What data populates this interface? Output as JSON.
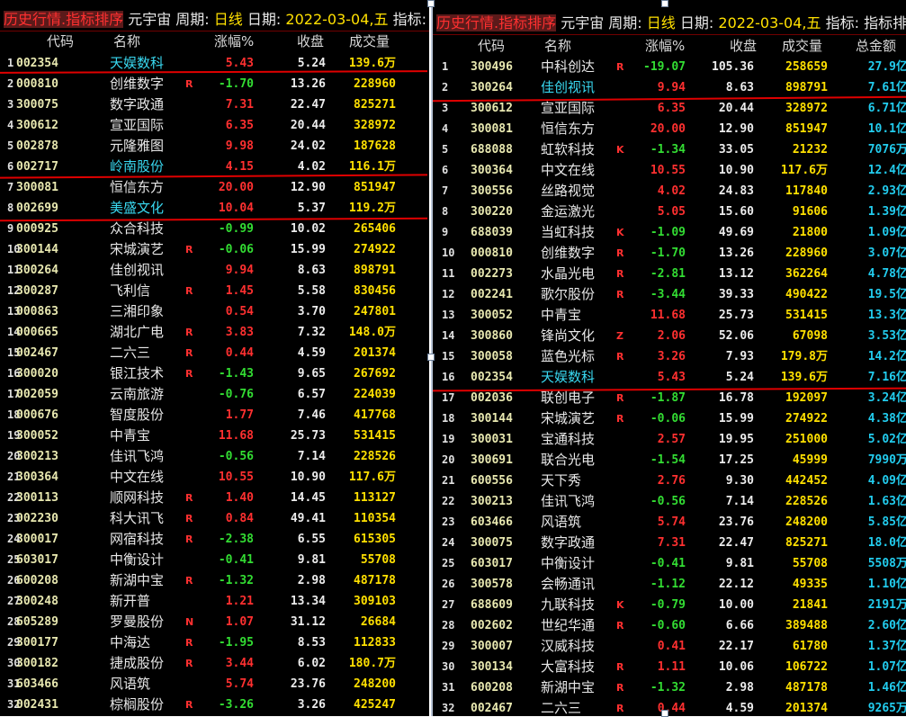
{
  "left": {
    "title": {
      "seg1": "历史行情.指标排序",
      "seg2": "元宇宙",
      "seg3": "周期:",
      "seg4": "日线",
      "seg5": "日期:",
      "seg6": "2022-03-04,五",
      "seg7": "指标:"
    },
    "headers": {
      "code": "代码",
      "name": "名称",
      "chg": "涨幅%",
      "close": "收盘",
      "vol": "成交量"
    },
    "rows": [
      {
        "idx": "1",
        "code": "002354",
        "name": "天娱数科",
        "tag": "",
        "chg": "5.43",
        "close": "5.24",
        "vol": "139.6万",
        "sel": true
      },
      {
        "idx": "2",
        "code": "000810",
        "name": "创维数字",
        "tag": "R",
        "chg": "-1.70",
        "close": "13.26",
        "vol": "228960"
      },
      {
        "idx": "3",
        "code": "300075",
        "name": "数字政通",
        "tag": "",
        "chg": "7.31",
        "close": "22.47",
        "vol": "825271"
      },
      {
        "idx": "4",
        "code": "300612",
        "name": "宣亚国际",
        "tag": "",
        "chg": "6.35",
        "close": "20.44",
        "vol": "328972"
      },
      {
        "idx": "5",
        "code": "002878",
        "name": "元隆雅图",
        "tag": "",
        "chg": "9.98",
        "close": "24.02",
        "vol": "187628"
      },
      {
        "idx": "6",
        "code": "002717",
        "name": "岭南股份",
        "tag": "",
        "chg": "4.15",
        "close": "4.02",
        "vol": "116.1万",
        "sel": true
      },
      {
        "idx": "7",
        "code": "300081",
        "name": "恒信东方",
        "tag": "",
        "chg": "20.00",
        "close": "12.90",
        "vol": "851947"
      },
      {
        "idx": "8",
        "code": "002699",
        "name": "美盛文化",
        "tag": "",
        "chg": "10.04",
        "close": "5.37",
        "vol": "119.2万",
        "sel": true
      },
      {
        "idx": "9",
        "code": "000925",
        "name": "众合科技",
        "tag": "",
        "chg": "-0.99",
        "close": "10.02",
        "vol": "265406"
      },
      {
        "idx": "10",
        "code": "300144",
        "name": "宋城演艺",
        "tag": "R",
        "chg": "-0.06",
        "close": "15.99",
        "vol": "274922"
      },
      {
        "idx": "11",
        "code": "300264",
        "name": "佳创视讯",
        "tag": "",
        "chg": "9.94",
        "close": "8.63",
        "vol": "898791"
      },
      {
        "idx": "12",
        "code": "300287",
        "name": "飞利信",
        "tag": "R",
        "chg": "1.45",
        "close": "5.58",
        "vol": "830456"
      },
      {
        "idx": "13",
        "code": "000863",
        "name": "三湘印象",
        "tag": "",
        "chg": "0.54",
        "close": "3.70",
        "vol": "247801"
      },
      {
        "idx": "14",
        "code": "000665",
        "name": "湖北广电",
        "tag": "R",
        "chg": "3.83",
        "close": "7.32",
        "vol": "148.0万"
      },
      {
        "idx": "15",
        "code": "002467",
        "name": "二六三",
        "tag": "R",
        "chg": "0.44",
        "close": "4.59",
        "vol": "201374"
      },
      {
        "idx": "16",
        "code": "300020",
        "name": "银江技术",
        "tag": "R",
        "chg": "-1.43",
        "close": "9.65",
        "vol": "267692"
      },
      {
        "idx": "17",
        "code": "002059",
        "name": "云南旅游",
        "tag": "",
        "chg": "-0.76",
        "close": "6.57",
        "vol": "224039"
      },
      {
        "idx": "18",
        "code": "000676",
        "name": "智度股份",
        "tag": "",
        "chg": "1.77",
        "close": "7.46",
        "vol": "417768"
      },
      {
        "idx": "19",
        "code": "300052",
        "name": "中青宝",
        "tag": "",
        "chg": "11.68",
        "close": "25.73",
        "vol": "531415"
      },
      {
        "idx": "20",
        "code": "300213",
        "name": "佳讯飞鸿",
        "tag": "",
        "chg": "-0.56",
        "close": "7.14",
        "vol": "228526"
      },
      {
        "idx": "21",
        "code": "300364",
        "name": "中文在线",
        "tag": "",
        "chg": "10.55",
        "close": "10.90",
        "vol": "117.6万"
      },
      {
        "idx": "22",
        "code": "300113",
        "name": "顺网科技",
        "tag": "R",
        "chg": "1.40",
        "close": "14.45",
        "vol": "113127"
      },
      {
        "idx": "23",
        "code": "002230",
        "name": "科大讯飞",
        "tag": "R",
        "chg": "0.84",
        "close": "49.41",
        "vol": "110354"
      },
      {
        "idx": "24",
        "code": "300017",
        "name": "网宿科技",
        "tag": "R",
        "chg": "-2.38",
        "close": "6.55",
        "vol": "615305"
      },
      {
        "idx": "25",
        "code": "603017",
        "name": "中衡设计",
        "tag": "",
        "chg": "-0.41",
        "close": "9.81",
        "vol": "55708"
      },
      {
        "idx": "26",
        "code": "600208",
        "name": "新湖中宝",
        "tag": "R",
        "chg": "-1.32",
        "close": "2.98",
        "vol": "487178"
      },
      {
        "idx": "27",
        "code": "300248",
        "name": "新开普",
        "tag": "",
        "chg": "1.21",
        "close": "13.34",
        "vol": "309103"
      },
      {
        "idx": "28",
        "code": "605289",
        "name": "罗曼股份",
        "tag": "N",
        "chg": "1.07",
        "close": "31.12",
        "vol": "26684"
      },
      {
        "idx": "29",
        "code": "300177",
        "name": "中海达",
        "tag": "R",
        "chg": "-1.95",
        "close": "8.53",
        "vol": "112833"
      },
      {
        "idx": "30",
        "code": "300182",
        "name": "捷成股份",
        "tag": "R",
        "chg": "3.44",
        "close": "6.02",
        "vol": "180.7万"
      },
      {
        "idx": "31",
        "code": "603466",
        "name": "风语筑",
        "tag": "",
        "chg": "5.74",
        "close": "23.76",
        "vol": "248200"
      },
      {
        "idx": "32",
        "code": "002431",
        "name": "棕榈股份",
        "tag": "R",
        "chg": "-3.26",
        "close": "3.26",
        "vol": "425247"
      }
    ]
  },
  "right": {
    "title": {
      "seg1": "历史行情.指标排序",
      "seg2": "元宇宙",
      "seg3": "周期:",
      "seg4": "日线",
      "seg5": "日期:",
      "seg6": "2022-03-04,五",
      "seg7": "指标:",
      "seg8": "指标排"
    },
    "headers": {
      "code": "代码",
      "name": "名称",
      "chg": "涨幅%",
      "close": "收盘",
      "vol": "成交量",
      "amt": "总金额"
    },
    "rows": [
      {
        "idx": "1",
        "code": "300496",
        "name": "中科创达",
        "tag": "R",
        "chg": "-19.07",
        "close": "105.36",
        "vol": "258659",
        "amt": "27.9亿"
      },
      {
        "idx": "2",
        "code": "300264",
        "name": "佳创视讯",
        "tag": "",
        "chg": "9.94",
        "close": "8.63",
        "vol": "898791",
        "amt": "7.61亿",
        "sel": true
      },
      {
        "idx": "3",
        "code": "300612",
        "name": "宣亚国际",
        "tag": "",
        "chg": "6.35",
        "close": "20.44",
        "vol": "328972",
        "amt": "6.71亿"
      },
      {
        "idx": "4",
        "code": "300081",
        "name": "恒信东方",
        "tag": "",
        "chg": "20.00",
        "close": "12.90",
        "vol": "851947",
        "amt": "10.1亿"
      },
      {
        "idx": "5",
        "code": "688088",
        "name": "虹软科技",
        "tag": "K",
        "chg": "-1.34",
        "close": "33.05",
        "vol": "21232",
        "amt": "7076万"
      },
      {
        "idx": "6",
        "code": "300364",
        "name": "中文在线",
        "tag": "",
        "chg": "10.55",
        "close": "10.90",
        "vol": "117.6万",
        "amt": "12.4亿"
      },
      {
        "idx": "7",
        "code": "300556",
        "name": "丝路视觉",
        "tag": "",
        "chg": "4.02",
        "close": "24.83",
        "vol": "117840",
        "amt": "2.93亿"
      },
      {
        "idx": "8",
        "code": "300220",
        "name": "金运激光",
        "tag": "",
        "chg": "5.05",
        "close": "15.60",
        "vol": "91606",
        "amt": "1.39亿"
      },
      {
        "idx": "9",
        "code": "688039",
        "name": "当虹科技",
        "tag": "K",
        "chg": "-1.09",
        "close": "49.69",
        "vol": "21800",
        "amt": "1.09亿"
      },
      {
        "idx": "10",
        "code": "000810",
        "name": "创维数字",
        "tag": "R",
        "chg": "-1.70",
        "close": "13.26",
        "vol": "228960",
        "amt": "3.07亿"
      },
      {
        "idx": "11",
        "code": "002273",
        "name": "水晶光电",
        "tag": "R",
        "chg": "-2.81",
        "close": "13.12",
        "vol": "362264",
        "amt": "4.78亿"
      },
      {
        "idx": "12",
        "code": "002241",
        "name": "歌尔股份",
        "tag": "R",
        "chg": "-3.44",
        "close": "39.33",
        "vol": "490422",
        "amt": "19.5亿"
      },
      {
        "idx": "13",
        "code": "300052",
        "name": "中青宝",
        "tag": "",
        "chg": "11.68",
        "close": "25.73",
        "vol": "531415",
        "amt": "13.3亿"
      },
      {
        "idx": "14",
        "code": "300860",
        "name": "锋尚文化",
        "tag": "Z",
        "chg": "2.06",
        "close": "52.06",
        "vol": "67098",
        "amt": "3.53亿"
      },
      {
        "idx": "15",
        "code": "300058",
        "name": "蓝色光标",
        "tag": "R",
        "chg": "3.26",
        "close": "7.93",
        "vol": "179.8万",
        "amt": "14.2亿"
      },
      {
        "idx": "16",
        "code": "002354",
        "name": "天娱数科",
        "tag": "",
        "chg": "5.43",
        "close": "5.24",
        "vol": "139.6万",
        "amt": "7.16亿",
        "sel": true
      },
      {
        "idx": "17",
        "code": "002036",
        "name": "联创电子",
        "tag": "R",
        "chg": "-1.87",
        "close": "16.78",
        "vol": "192097",
        "amt": "3.24亿"
      },
      {
        "idx": "18",
        "code": "300144",
        "name": "宋城演艺",
        "tag": "R",
        "chg": "-0.06",
        "close": "15.99",
        "vol": "274922",
        "amt": "4.38亿"
      },
      {
        "idx": "19",
        "code": "300031",
        "name": "宝通科技",
        "tag": "",
        "chg": "2.57",
        "close": "19.95",
        "vol": "251000",
        "amt": "5.02亿"
      },
      {
        "idx": "20",
        "code": "300691",
        "name": "联合光电",
        "tag": "",
        "chg": "-1.54",
        "close": "17.25",
        "vol": "45999",
        "amt": "7990万"
      },
      {
        "idx": "21",
        "code": "600556",
        "name": "天下秀",
        "tag": "",
        "chg": "2.76",
        "close": "9.30",
        "vol": "442452",
        "amt": "4.09亿"
      },
      {
        "idx": "22",
        "code": "300213",
        "name": "佳讯飞鸿",
        "tag": "",
        "chg": "-0.56",
        "close": "7.14",
        "vol": "228526",
        "amt": "1.63亿"
      },
      {
        "idx": "23",
        "code": "603466",
        "name": "风语筑",
        "tag": "",
        "chg": "5.74",
        "close": "23.76",
        "vol": "248200",
        "amt": "5.85亿"
      },
      {
        "idx": "24",
        "code": "300075",
        "name": "数字政通",
        "tag": "",
        "chg": "7.31",
        "close": "22.47",
        "vol": "825271",
        "amt": "18.0亿"
      },
      {
        "idx": "25",
        "code": "603017",
        "name": "中衡设计",
        "tag": "",
        "chg": "-0.41",
        "close": "9.81",
        "vol": "55708",
        "amt": "5508万"
      },
      {
        "idx": "26",
        "code": "300578",
        "name": "会畅通讯",
        "tag": "",
        "chg": "-1.12",
        "close": "22.12",
        "vol": "49335",
        "amt": "1.10亿"
      },
      {
        "idx": "27",
        "code": "688609",
        "name": "九联科技",
        "tag": "K",
        "chg": "-0.79",
        "close": "10.00",
        "vol": "21841",
        "amt": "2191万"
      },
      {
        "idx": "28",
        "code": "002602",
        "name": "世纪华通",
        "tag": "R",
        "chg": "-0.60",
        "close": "6.66",
        "vol": "389488",
        "amt": "2.60亿"
      },
      {
        "idx": "29",
        "code": "300007",
        "name": "汉威科技",
        "tag": "",
        "chg": "0.41",
        "close": "22.17",
        "vol": "61780",
        "amt": "1.37亿"
      },
      {
        "idx": "30",
        "code": "300134",
        "name": "大富科技",
        "tag": "R",
        "chg": "1.11",
        "close": "10.06",
        "vol": "106722",
        "amt": "1.07亿"
      },
      {
        "idx": "31",
        "code": "600208",
        "name": "新湖中宝",
        "tag": "R",
        "chg": "-1.32",
        "close": "2.98",
        "vol": "487178",
        "amt": "1.46亿"
      },
      {
        "idx": "32",
        "code": "002467",
        "name": "二六三",
        "tag": "R",
        "chg": "0.44",
        "close": "4.59",
        "vol": "201374",
        "amt": "9265万"
      }
    ]
  },
  "colors": {
    "up": "#ff3030",
    "down": "#33dd33",
    "background": "#000000",
    "selected_name": "#39d8f0",
    "amount": "#22ccee"
  }
}
